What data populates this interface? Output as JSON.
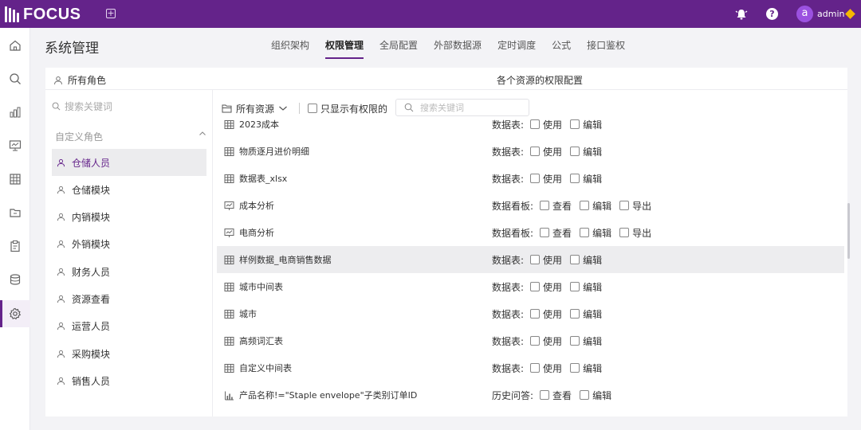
{
  "app": {
    "logo_text": "FOCUS",
    "user": "admin",
    "avatar_letter": "a"
  },
  "page_title": "系统管理",
  "tabs": [
    "组织架构",
    "权限管理",
    "全局配置",
    "外部数据源",
    "定时调度",
    "公式",
    "接口鉴权"
  ],
  "active_tab": "权限管理",
  "roles_panel": {
    "title": "所有角色",
    "search_placeholder": "搜索关键词",
    "group": "自定义角色",
    "roles": [
      "仓储人员",
      "仓储模块",
      "内销模块",
      "外销模块",
      "财务人员",
      "资源查看",
      "运营人员",
      "采购模块",
      "销售人员"
    ],
    "active_role": "仓储人员"
  },
  "resources_panel": {
    "title": "各个资源的权限配置",
    "filter": "所有资源",
    "only_with_permission": "只显示有权限的",
    "search_placeholder": "搜索关键词",
    "rows": [
      {
        "name": "2023成本",
        "icon": "table-icon",
        "type": "数据表:",
        "options": [
          "使用",
          "编辑"
        ]
      },
      {
        "name": "物质逐月进价明细",
        "icon": "table-icon",
        "type": "数据表:",
        "options": [
          "使用",
          "编辑"
        ]
      },
      {
        "name": "数据表_xlsx",
        "icon": "table-icon",
        "type": "数据表:",
        "options": [
          "使用",
          "编辑"
        ]
      },
      {
        "name": "成本分析",
        "icon": "dashboard-icon",
        "type": "数据看板:",
        "options": [
          "查看",
          "编辑",
          "导出"
        ]
      },
      {
        "name": "电商分析",
        "icon": "dashboard-icon",
        "type": "数据看板:",
        "options": [
          "查看",
          "编辑",
          "导出"
        ]
      },
      {
        "name": "样例数据_电商销售数据",
        "icon": "table-icon",
        "type": "数据表:",
        "options": [
          "使用",
          "编辑"
        ]
      },
      {
        "name": "城市中间表",
        "icon": "table-icon",
        "type": "数据表:",
        "options": [
          "使用",
          "编辑"
        ]
      },
      {
        "name": "城市",
        "icon": "table-icon",
        "type": "数据表:",
        "options": [
          "使用",
          "编辑"
        ]
      },
      {
        "name": "高频词汇表",
        "icon": "table-icon",
        "type": "数据表:",
        "options": [
          "使用",
          "编辑"
        ]
      },
      {
        "name": "自定义中间表",
        "icon": "table-icon",
        "type": "数据表:",
        "options": [
          "使用",
          "编辑"
        ]
      },
      {
        "name": "产品名称!=\"Staple envelope\"子类别订单ID",
        "icon": "chart-icon",
        "type": "历史问答:",
        "options": [
          "查看",
          "编辑"
        ]
      }
    ],
    "highlighted_row": "样例数据_电商销售数据"
  },
  "colors": {
    "brand": "#64238a",
    "accent_badge": "#f5b800"
  }
}
